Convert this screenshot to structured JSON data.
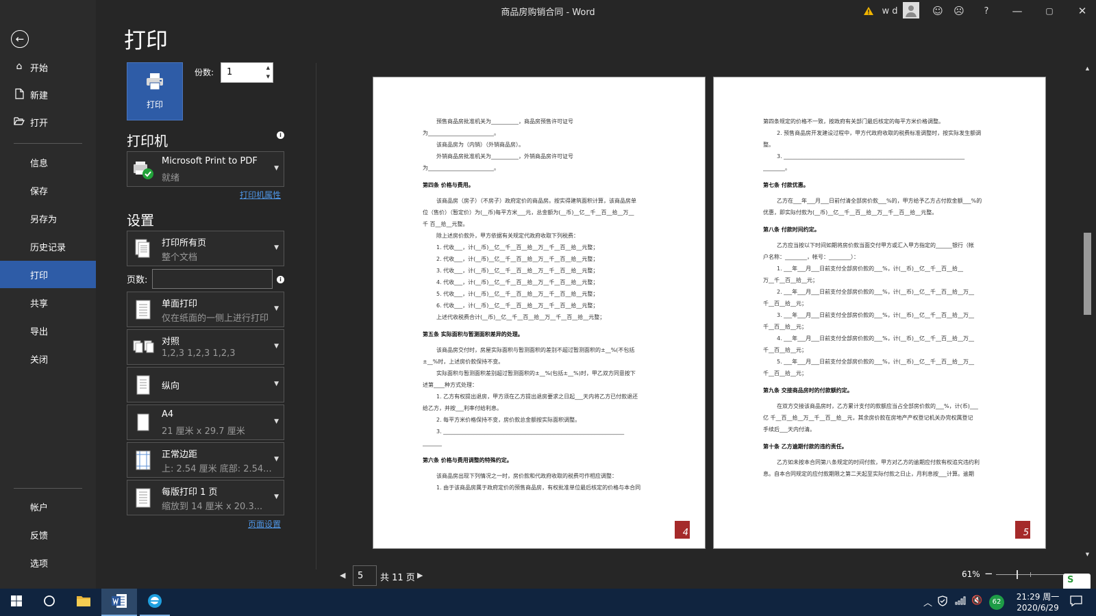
{
  "window": {
    "title": "商品房购销合同  -  Word",
    "user": "w d",
    "help": "?",
    "min": "—",
    "max": "▢",
    "close": "✕"
  },
  "sidebar": {
    "items": [
      {
        "label": "开始",
        "icon": "home-icon"
      },
      {
        "label": "新建",
        "icon": "new-document-icon"
      },
      {
        "label": "打开",
        "icon": "open-folder-icon"
      },
      {
        "label": "信息"
      },
      {
        "label": "保存"
      },
      {
        "label": "另存为"
      },
      {
        "label": "历史记录"
      },
      {
        "label": "打印",
        "active": true
      },
      {
        "label": "共享"
      },
      {
        "label": "导出"
      },
      {
        "label": "关闭"
      },
      {
        "label": "帐户"
      },
      {
        "label": "反馈"
      },
      {
        "label": "选项"
      }
    ]
  },
  "print": {
    "heading": "打印",
    "print_button": "打印",
    "copies_label": "份数:",
    "copies_value": "1",
    "printer_heading": "打印机",
    "printer_name": "Microsoft Print to PDF",
    "printer_status": "就绪",
    "printer_properties": "打印机属性",
    "settings_heading": "设置",
    "pages_label": "页数:",
    "pages_value": "",
    "settings": [
      {
        "line1": "打印所有页",
        "line2": "整个文档"
      },
      {
        "line1": "单面打印",
        "line2": "仅在纸面的一侧上进行打印"
      },
      {
        "line1": "对照",
        "line2": "1,2,3    1,2,3    1,2,3"
      },
      {
        "line1": "纵向",
        "line2": ""
      },
      {
        "line1": "A4",
        "line2": "21 厘米 x 29.7 厘米"
      },
      {
        "line1": "正常边距",
        "line2": "上: 2.54 厘米 底部: 2.54..."
      },
      {
        "line1": "每版打印 1 页",
        "line2": "缩放到 14 厘米 x 20.3..."
      }
    ],
    "page_setup": "页面设置"
  },
  "preview": {
    "left_page_number": "4",
    "right_page_number": "5",
    "left_page": [
      {
        "t": "预售商品房批准机关为__________，商品房预售许可证号",
        "c": "ind"
      },
      {
        "t": "为________________________。",
        "c": ""
      },
      {
        "t": "该商品房为（内销）（外销商品房）。",
        "c": "ind"
      },
      {
        "t": "外销商品房批准机关为__________，外销商品房许可证号",
        "c": "ind"
      },
      {
        "t": "为________________________。",
        "c": ""
      },
      {
        "t": "第四条  价格与费用。",
        "c": "hd"
      },
      {
        "t": "该商品房（房子）（不房子）政府定价的商品房。按实得建筑面积计算，该商品房单",
        "c": "ind"
      },
      {
        "t": "位（售价）（暂定价）为(__币)每平方米___元，总金额为(__币)__亿__千__百__拾__万__",
        "c": ""
      },
      {
        "t": "千  百__拾__元整。",
        "c": ""
      },
      {
        "t": "除上述房价款外，甲方依据有关规定代政府收取下列税费：",
        "c": "ind"
      },
      {
        "t": "1. 代收___，计(__币)__亿__千__百__拾__万__千__百__拾__元整；",
        "c": "ind"
      },
      {
        "t": "2. 代收___，计(__币)__亿__千__百__拾__万__千__百__拾__元整；",
        "c": "ind"
      },
      {
        "t": "3. 代收___，计(__币)__亿__千__百__拾__万__千__百__拾__元整；",
        "c": "ind"
      },
      {
        "t": "4. 代收___，计(__币)__亿__千__百__拾__万__千__百__拾__元整；",
        "c": "ind"
      },
      {
        "t": "5. 代收___，计(__币)__亿__千__百__拾__万__千__百__拾__元整；",
        "c": "ind"
      },
      {
        "t": "6. 代收___，计(__币)__亿__千__百__拾__万__千__百__拾__元整；",
        "c": "ind"
      },
      {
        "t": "上述代收税费合计(__币)__亿__千__百__拾__万__千__百__拾__元整；",
        "c": "ind"
      },
      {
        "t": "第五条  实际面积与暂测面积差异的处理。",
        "c": "hd"
      },
      {
        "t": "该商品房交付时，房屋实际面积与暂测面积的差别不超过暂测面积的±__%(不包括",
        "c": "ind"
      },
      {
        "t": "±__%时，上述房价款保持不变。",
        "c": ""
      },
      {
        "t": "实际面积与暂测面积差别超过暂测面积的±__%(包括±__%)时，甲乙双方同意按下",
        "c": "ind"
      },
      {
        "t": "述第____种方式处理：",
        "c": ""
      },
      {
        "t": "1. 乙方有权提出退房，甲方须在乙方提出退房要求之日起___天内将乙方已付款退还",
        "c": "ind"
      },
      {
        "t": "给乙方，并按___利率付给利息。",
        "c": ""
      },
      {
        "t": "2. 每平方米价格保持不变，房价款总金额按实际面积调整。",
        "c": "ind"
      },
      {
        "t": "3. __________________________________________________________________",
        "c": "ind"
      },
      {
        "t": "_______",
        "c": ""
      },
      {
        "t": "第六条  价格与费用调整的特殊约定。",
        "c": "hd"
      },
      {
        "t": "该商品房出现下列情况之一时，房价款和代政府收取的税费可作相应调整：",
        "c": "ind"
      },
      {
        "t": "1. 由于该商品房属于政府定价的预售商品房，有权批准单位最后核定的价格与本合同",
        "c": "ind"
      }
    ],
    "right_page": [
      {
        "t": "第四条规定的价格不一致，按政府有关部门最后核定的每平方米价格调整。",
        "c": ""
      },
      {
        "t": "2. 预售商品房开发建设过程中，甲方代政府收取的税费标准调整时，按实际发生额调",
        "c": "ind"
      },
      {
        "t": "整。",
        "c": ""
      },
      {
        "t": "3. __________________________________________________________________",
        "c": "ind"
      },
      {
        "t": "________。",
        "c": ""
      },
      {
        "t": "第七条  付款优惠。",
        "c": "hd"
      },
      {
        "t": "乙方在___年___月___日前付清全部房价款___%的，甲方给予乙方占付款金额___%的",
        "c": "ind"
      },
      {
        "t": "优惠，即实际付款为(__币)__亿__千__百__拾__万__千__百__拾__元整。",
        "c": ""
      },
      {
        "t": "第八条  付款时间约定。",
        "c": "hd"
      },
      {
        "t": "乙方应当按以下时间如期将房价款当面交付甲方或汇入甲方指定的______银行（帐",
        "c": "ind"
      },
      {
        "t": "户名称：________，帐号：________）：",
        "c": ""
      },
      {
        "t": "1. ___年___月___日前支付全部房价款的___%，计(__币)__亿__千__百__拾__",
        "c": "ind"
      },
      {
        "t": "万__千__百__拾__元；",
        "c": ""
      },
      {
        "t": "2. ___年___月___日前支付全部房价款的___%，计(__币)__亿__千__百__拾__万__",
        "c": "ind"
      },
      {
        "t": "千__百__拾__元；",
        "c": ""
      },
      {
        "t": "3. ___年___月___日前支付全部房价款的___%，计(__币)__亿__千__百__拾__万__",
        "c": "ind"
      },
      {
        "t": "千__百__拾__元；",
        "c": ""
      },
      {
        "t": "4. ___年___月___日前支付全部房价款的___%，计(__币)__亿__千__百__拾__万__",
        "c": "ind"
      },
      {
        "t": "千__百__拾__元；",
        "c": ""
      },
      {
        "t": "5. ___年___月___日前支付全部房价款的___%，计(__币)__亿__千__百__拾__万__",
        "c": "ind"
      },
      {
        "t": "千__百__拾__元；",
        "c": ""
      },
      {
        "t": "第九条  交接商品房时的付款额约定。",
        "c": "hd"
      },
      {
        "t": "在双方交接该商品房时，乙方累计支付的款额应当占全部房价款的___%，计(币)___",
        "c": "ind"
      },
      {
        "t": "亿  千__百__拾__万__千__百__拾__元，其余房价款在房地产产权登记机关办完权属登记",
        "c": ""
      },
      {
        "t": "手续后___天内付清。",
        "c": ""
      },
      {
        "t": "第十条  乙方逾期付款的违约责任。",
        "c": "hd"
      },
      {
        "t": "乙方如未按本合同第八条规定的时间付款，甲方对乙方的逾期应付款有权追究违约利",
        "c": "ind"
      },
      {
        "t": "息。自本合同规定的应付款期限之第二天起至实际付款之日止，月利息按___计算。逾期",
        "c": ""
      }
    ],
    "current_page": "5",
    "total_pages": "共 11 页",
    "zoom": "61%",
    "zoom_level": 0.61
  },
  "taskbar": {
    "battery": "62",
    "time": "21:29 周一",
    "date": "2020/6/29",
    "sogou": "S"
  },
  "colors": {
    "accent": "#2e5ca7",
    "link": "#4f96e6",
    "page_badge": "#a52a2a"
  }
}
